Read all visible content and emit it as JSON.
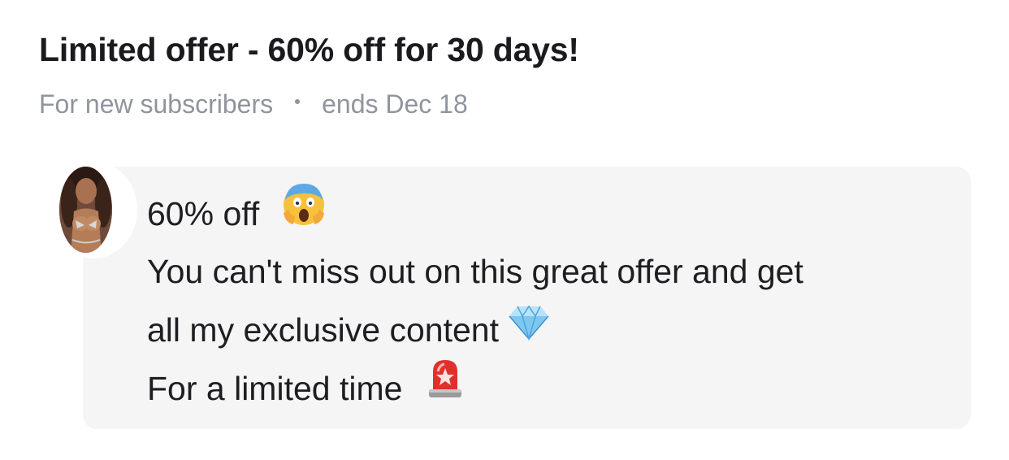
{
  "offer": {
    "title": "Limited offer - 60% off for 30 days!",
    "audience": "For new subscribers",
    "ends": "ends Dec 18"
  },
  "message": {
    "line1": "60% off",
    "line2": "You can't miss out on this great offer and get",
    "line3": "all my exclusive content",
    "line4": "For a limited time",
    "icons": {
      "line1": "face-screaming-in-fear-icon",
      "line3": "gem-stone-icon",
      "line4": "police-light-icon"
    }
  },
  "colors": {
    "title": "#1b1b1f",
    "meta": "#8f959c",
    "card_background": "#f5f5f6",
    "message_text": "#1e1e22"
  }
}
